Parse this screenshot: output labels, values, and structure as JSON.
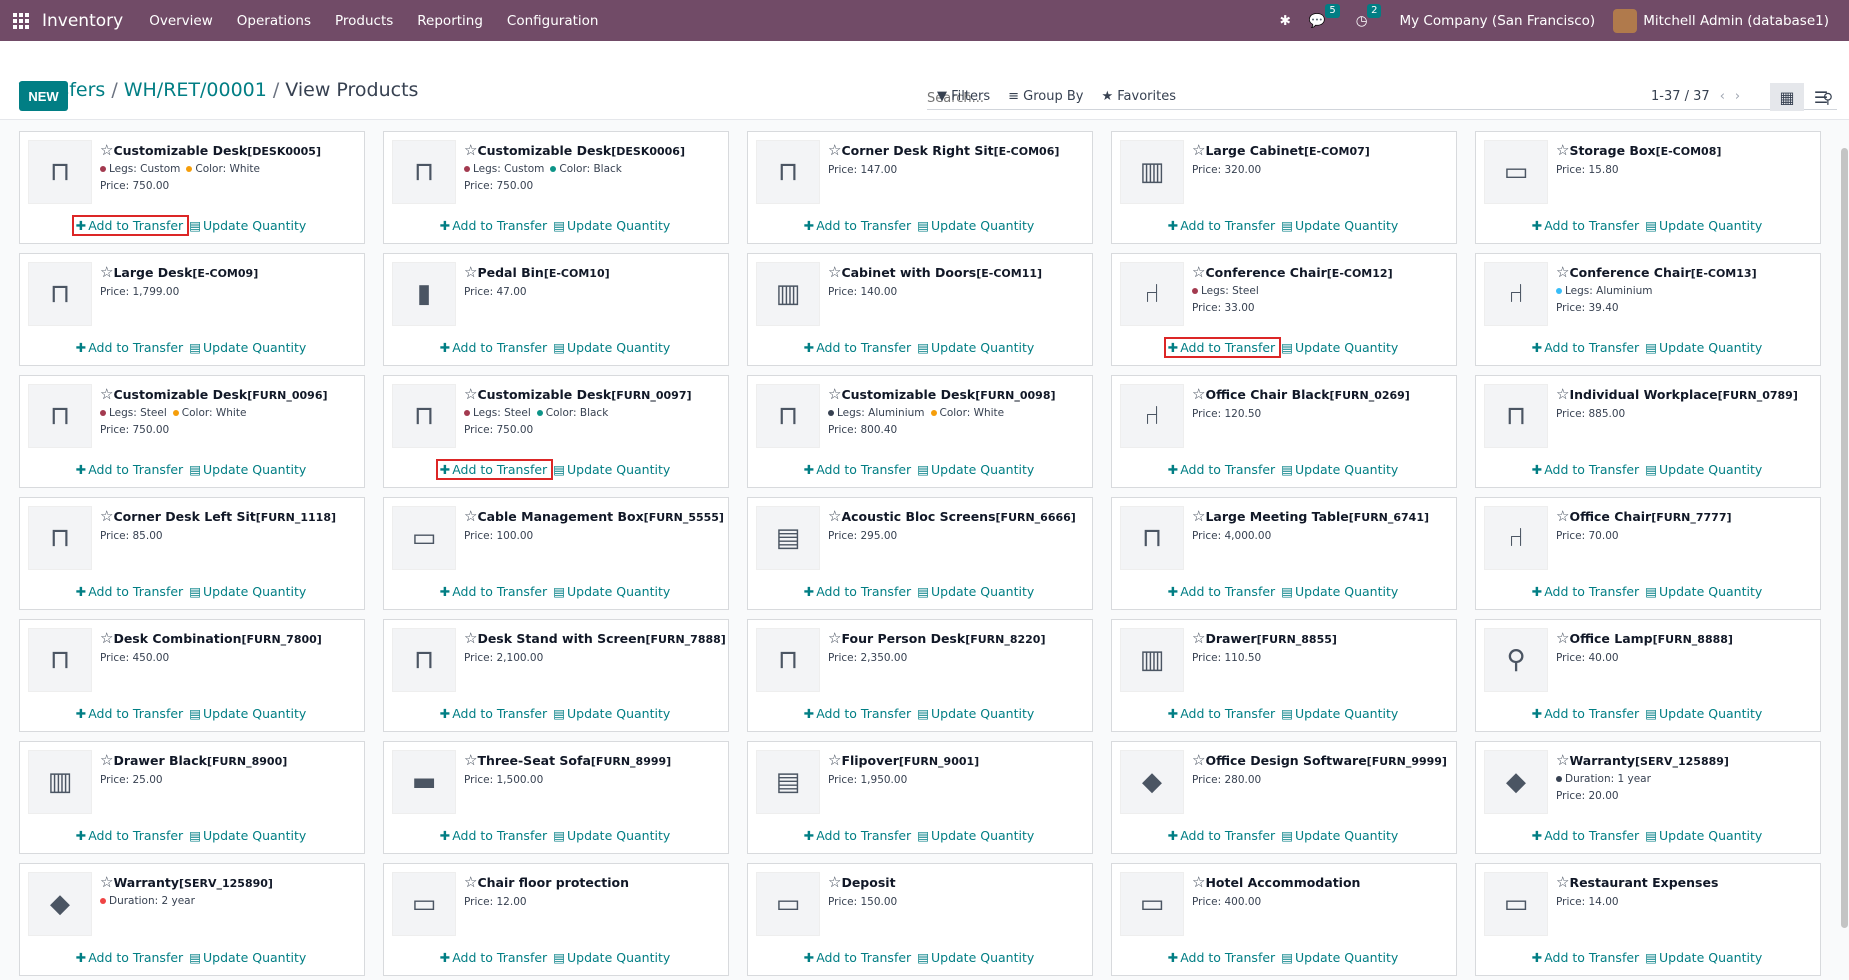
{
  "nav": {
    "app_name": "Inventory",
    "menu": [
      "Overview",
      "Operations",
      "Products",
      "Reporting",
      "Configuration"
    ],
    "messages_count": "5",
    "activities_count": "2",
    "company": "My Company (San Francisco)",
    "user": "Mitchell Admin (database1)"
  },
  "breadcrumb": [
    "Transfers",
    "WH/RET/00001",
    "View Products"
  ],
  "new_label": "NEW",
  "search": {
    "placeholder": "Search..."
  },
  "toolbar": {
    "filters": "Filters",
    "group_by": "Group By",
    "favorites": "Favorites"
  },
  "pager": "1-37 / 37",
  "actions": {
    "add": "Add to Transfer",
    "update": "Update Quantity"
  },
  "products": [
    {
      "name": "Customizable Desk",
      "ref": "[DESK0005]",
      "attrs": [
        {
          "t": "Legs: Custom",
          "c": "#a33a4f"
        },
        {
          "t": "Color: White",
          "c": "#f59e0b"
        }
      ],
      "price": "Price: 750.00",
      "icon": "desk",
      "highlight": true
    },
    {
      "name": "Customizable Desk",
      "ref": "[DESK0006]",
      "attrs": [
        {
          "t": "Legs: Custom",
          "c": "#a33a4f"
        },
        {
          "t": "Color: Black",
          "c": "#0d9488"
        }
      ],
      "price": "Price: 750.00",
      "icon": "desk"
    },
    {
      "name": "Corner Desk Right Sit",
      "ref": "[E-COM06]",
      "attrs": [],
      "price": "Price: 147.00",
      "icon": "desk"
    },
    {
      "name": "Large Cabinet",
      "ref": "[E-COM07]",
      "attrs": [],
      "price": "Price: 320.00",
      "icon": "cabinet"
    },
    {
      "name": "Storage Box",
      "ref": "[E-COM08]",
      "attrs": [],
      "price": "Price: 15.80",
      "icon": "box"
    },
    {
      "name": "Large Desk",
      "ref": "[E-COM09]",
      "attrs": [],
      "price": "Price: 1,799.00",
      "icon": "desk"
    },
    {
      "name": "Pedal Bin",
      "ref": "[E-COM10]",
      "attrs": [],
      "price": "Price: 47.00",
      "icon": "bin"
    },
    {
      "name": "Cabinet with Doors",
      "ref": "[E-COM11]",
      "attrs": [],
      "price": "Price: 140.00",
      "icon": "cabinet"
    },
    {
      "name": "Conference Chair",
      "ref": "[E-COM12]",
      "attrs": [
        {
          "t": "Legs: Steel",
          "c": "#a33a4f"
        }
      ],
      "price": "Price: 33.00",
      "icon": "chair",
      "highlight": true
    },
    {
      "name": "Conference Chair",
      "ref": "[E-COM13]",
      "attrs": [
        {
          "t": "Legs: Aluminium",
          "c": "#38bdf8"
        }
      ],
      "price": "Price: 39.40",
      "icon": "chair"
    },
    {
      "name": "Customizable Desk",
      "ref": "[FURN_0096]",
      "attrs": [
        {
          "t": "Legs: Steel",
          "c": "#a33a4f"
        },
        {
          "t": "Color: White",
          "c": "#f59e0b"
        }
      ],
      "price": "Price: 750.00",
      "icon": "desk"
    },
    {
      "name": "Customizable Desk",
      "ref": "[FURN_0097]",
      "attrs": [
        {
          "t": "Legs: Steel",
          "c": "#a33a4f"
        },
        {
          "t": "Color: Black",
          "c": "#0d9488"
        }
      ],
      "price": "Price: 750.00",
      "icon": "desk",
      "highlight": true
    },
    {
      "name": "Customizable Desk",
      "ref": "[FURN_0098]",
      "attrs": [
        {
          "t": "Legs: Aluminium",
          "c": "#374151"
        },
        {
          "t": "Color: White",
          "c": "#f59e0b"
        }
      ],
      "price": "Price: 800.40",
      "icon": "desk"
    },
    {
      "name": "Office Chair Black",
      "ref": "[FURN_0269]",
      "attrs": [],
      "price": "Price: 120.50",
      "icon": "chair"
    },
    {
      "name": "Individual Workplace",
      "ref": "[FURN_0789]",
      "attrs": [],
      "price": "Price: 885.00",
      "icon": "desk"
    },
    {
      "name": "Corner Desk Left Sit",
      "ref": "[FURN_1118]",
      "attrs": [],
      "price": "Price: 85.00",
      "icon": "desk"
    },
    {
      "name": "Cable Management Box",
      "ref": "[FURN_5555]",
      "attrs": [],
      "price": "Price: 100.00",
      "icon": "box"
    },
    {
      "name": "Acoustic Bloc Screens",
      "ref": "[FURN_6666]",
      "attrs": [],
      "price": "Price: 295.00",
      "icon": "screen"
    },
    {
      "name": "Large Meeting Table",
      "ref": "[FURN_6741]",
      "attrs": [],
      "price": "Price: 4,000.00",
      "icon": "desk"
    },
    {
      "name": "Office Chair",
      "ref": "[FURN_7777]",
      "attrs": [],
      "price": "Price: 70.00",
      "icon": "chair"
    },
    {
      "name": "Desk Combination",
      "ref": "[FURN_7800]",
      "attrs": [],
      "price": "Price: 450.00",
      "icon": "desk"
    },
    {
      "name": "Desk Stand with Screen",
      "ref": "[FURN_7888]",
      "attrs": [],
      "price": "Price: 2,100.00",
      "icon": "desk"
    },
    {
      "name": "Four Person Desk",
      "ref": "[FURN_8220]",
      "attrs": [],
      "price": "Price: 2,350.00",
      "icon": "desk"
    },
    {
      "name": "Drawer",
      "ref": "[FURN_8855]",
      "attrs": [],
      "price": "Price: 110.50",
      "icon": "cabinet"
    },
    {
      "name": "Office Lamp",
      "ref": "[FURN_8888]",
      "attrs": [],
      "price": "Price: 40.00",
      "icon": "lamp"
    },
    {
      "name": "Drawer Black",
      "ref": "[FURN_8900]",
      "attrs": [],
      "price": "Price: 25.00",
      "icon": "cabinet"
    },
    {
      "name": "Three-Seat Sofa",
      "ref": "[FURN_8999]",
      "attrs": [],
      "price": "Price: 1,500.00",
      "icon": "sofa"
    },
    {
      "name": "Flipover",
      "ref": "[FURN_9001]",
      "attrs": [],
      "price": "Price: 1,950.00",
      "icon": "screen"
    },
    {
      "name": "Office Design Software",
      "ref": "[FURN_9999]",
      "attrs": [],
      "price": "Price: 280.00",
      "icon": "software"
    },
    {
      "name": "Warranty",
      "ref": "[SERV_125889]",
      "attrs": [
        {
          "t": "Duration: 1 year",
          "c": "#374151"
        }
      ],
      "price": "Price: 20.00",
      "icon": "software"
    },
    {
      "name": "Warranty",
      "ref": "[SERV_125890]",
      "attrs": [
        {
          "t": "Duration: 2 year",
          "c": "#ef4444"
        }
      ],
      "price": "",
      "icon": "software"
    },
    {
      "name": "Chair floor protection",
      "ref": "",
      "attrs": [],
      "price": "Price: 12.00",
      "icon": "box"
    },
    {
      "name": "Deposit",
      "ref": "",
      "attrs": [],
      "price": "Price: 150.00",
      "icon": "box"
    },
    {
      "name": "Hotel Accommodation",
      "ref": "",
      "attrs": [],
      "price": "Price: 400.00",
      "icon": "box"
    },
    {
      "name": "Restaurant Expenses",
      "ref": "",
      "attrs": [],
      "price": "Price: 14.00",
      "icon": "box"
    }
  ]
}
